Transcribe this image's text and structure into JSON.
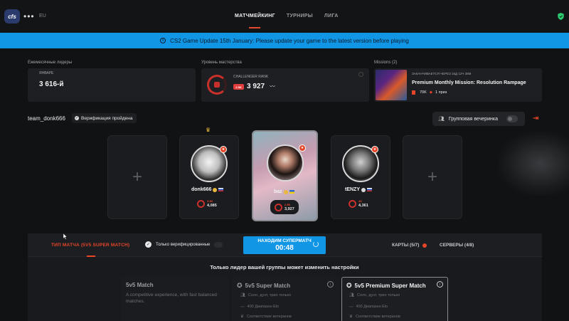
{
  "header": {
    "logo_text": "cfs",
    "region": "EU",
    "tabs": [
      {
        "label": "МАТЧМЕЙКИНГ",
        "active": true
      },
      {
        "label": "ТУРНИРЫ",
        "active": false
      },
      {
        "label": "ЛИГА",
        "active": false
      }
    ],
    "accent_color": "#e5462a"
  },
  "banner": {
    "text": "CS2 Game Update 15th January: Please update your game to the latest version before playing",
    "color": "#1196e6"
  },
  "stats": {
    "leaders": {
      "label": "Ежемесячные лидеры",
      "month": "ЯНВАРЕ",
      "value": "3 616-й"
    },
    "mastery": {
      "label": "Уровень мастерства",
      "rank_title": "CHALLENGER RANK",
      "rank_badge": "2.5K",
      "elo": "3 927"
    },
    "missions": {
      "label": "Missions (2)",
      "ends_in": "ЗАКАНЧИВАЕТСЯ ЧЕРЕЗ 16Д 12Ч 38М",
      "title": "Premium Monthly Mission: Resolution Rampage",
      "xp": "70K",
      "prize": "1 приз"
    }
  },
  "party": {
    "team_name": "team_donk666",
    "verified_label": "Верификация пройдена",
    "group_party_label": "Групповая вечеринка"
  },
  "players": [
    {
      "name": "donk666",
      "flag": "ru",
      "elo_rank": "3.9K",
      "elo": "4,085",
      "leader": true
    },
    {
      "name": "baz",
      "flag": "ua",
      "elo_rank": "2.5K",
      "elo": "3,927",
      "leader": false
    },
    {
      "name": "tENZY",
      "flag": "ru",
      "elo_rank": "4K",
      "elo": "4,361",
      "leader": false
    }
  ],
  "matchbar": {
    "match_type": "ТИП МАТЧА (5V5 SUPER MATCH)",
    "verified_only": "Только верифицированные",
    "search_label": "НАХОДИМ СУПЕРМАТЧ",
    "timer": "00:48",
    "maps": "КАРТЫ (5/7)",
    "servers": "СЕРВЕРЫ (4/8)",
    "leader_notice": "Только лидер вашей группы может изменить настройки"
  },
  "modes": [
    {
      "title": "5v5 Match",
      "desc": "A competitive experience, with fast balanced matches.",
      "features": []
    },
    {
      "title": "5v5 Super Match",
      "desc": "",
      "features": [
        "Соло, дуэт, трио только",
        "400 Диапазон Elo",
        "Соответствие ветеранов"
      ]
    },
    {
      "title": "5v5 Premium Super Match",
      "desc": "",
      "features": [
        "Соло, дуэт, трио только",
        "400 Диапазон Elo",
        "Соответствие ветеранов"
      ]
    }
  ]
}
